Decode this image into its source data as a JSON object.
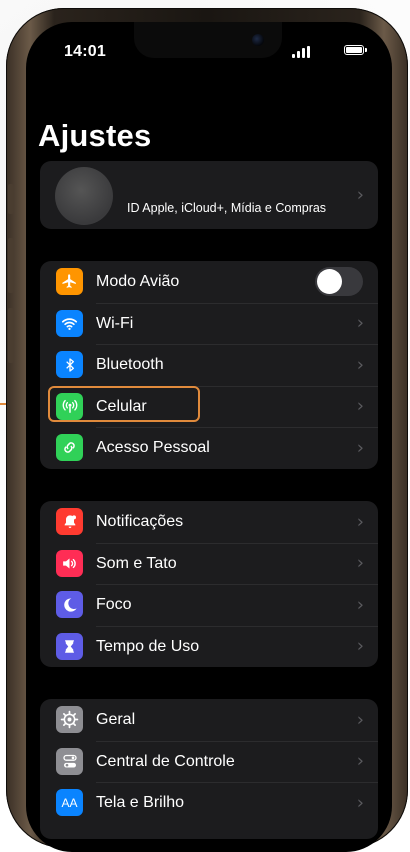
{
  "status_bar": {
    "time": "14:01"
  },
  "title": "Ajustes",
  "profile": {
    "subtitle": "ID Apple, iCloud+, Mídia e Compras"
  },
  "groups": [
    {
      "items": [
        {
          "label": "Modo Avião",
          "icon": "airplane-icon",
          "color": "#ff9500",
          "control": "toggle",
          "toggle_on": false
        },
        {
          "label": "Wi-Fi",
          "icon": "wifi-icon",
          "color": "#0a84ff",
          "control": "chevron"
        },
        {
          "label": "Bluetooth",
          "icon": "bluetooth-icon",
          "color": "#0a84ff",
          "control": "chevron"
        },
        {
          "label": "Celular",
          "icon": "antenna-icon",
          "color": "#30d158",
          "control": "chevron",
          "highlighted": true
        },
        {
          "label": "Acesso Pessoal",
          "icon": "link-icon",
          "color": "#30d158",
          "control": "chevron"
        }
      ]
    },
    {
      "items": [
        {
          "label": "Notificações",
          "icon": "bell-icon",
          "color": "#ff3b30",
          "control": "chevron"
        },
        {
          "label": "Som e Tato",
          "icon": "speaker-icon",
          "color": "#ff2d55",
          "control": "chevron"
        },
        {
          "label": "Foco",
          "icon": "moon-icon",
          "color": "#5e5ce6",
          "control": "chevron"
        },
        {
          "label": "Tempo de Uso",
          "icon": "hourglass-icon",
          "color": "#5e5ce6",
          "control": "chevron"
        }
      ]
    },
    {
      "items": [
        {
          "label": "Geral",
          "icon": "gear-icon",
          "color": "#8e8e93",
          "control": "chevron"
        },
        {
          "label": "Central de Controle",
          "icon": "switches-icon",
          "color": "#8e8e93",
          "control": "chevron"
        },
        {
          "label": "Tela e Brilho",
          "icon": "text-size-icon",
          "color": "#0a84ff",
          "control": "chevron",
          "icon_text": "AA"
        }
      ]
    }
  ],
  "accent": {
    "highlight": "#e08a3c",
    "chevron": "#5a5a5e"
  }
}
